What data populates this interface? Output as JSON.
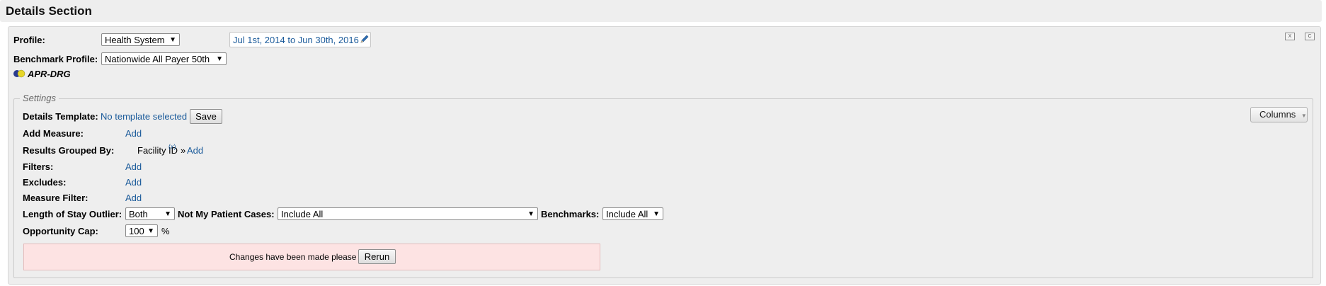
{
  "header": {
    "title": "Details Section"
  },
  "profile": {
    "label": "Profile:",
    "value": "Health System",
    "date_range": "Jul 1st, 2014 to Jun 30th, 2016",
    "benchmark_label": "Benchmark Profile:",
    "benchmark_value": "Nationwide All Payer 50th",
    "grouper": "APR-DRG"
  },
  "settings": {
    "legend": "Settings",
    "columns_button": "Columns",
    "details_template_label": "Details Template:",
    "details_template_value": "No template selected",
    "save_button": "Save",
    "add_measure_label": "Add Measure:",
    "add_link": "Add",
    "results_grouped_label": "Results Grouped By:",
    "grouped_value": "Facility ID",
    "grouped_remove": "(x)",
    "grouped_separator": "»",
    "filters_label": "Filters:",
    "excludes_label": "Excludes:",
    "measure_filter_label": "Measure Filter:",
    "los_outlier_label": "Length of Stay Outlier:",
    "los_outlier_value": "Both",
    "not_my_patient_label": "Not My Patient Cases:",
    "not_my_patient_value": "Include All",
    "benchmarks_label": "Benchmarks:",
    "benchmarks_value": "Include All",
    "opportunity_cap_label": "Opportunity Cap:",
    "opportunity_cap_value": "100",
    "opportunity_cap_unit": "%",
    "alert_text": "Changes have been made please",
    "rerun_button": "Rerun"
  },
  "icons": {
    "dropdown": "▼",
    "edit": "pencil-icon",
    "toggle": "toggle-icon",
    "export_1": "export-excel-icon",
    "export_2": "export-csv-icon"
  },
  "colors": {
    "link": "#1a5a9a",
    "panel_bg": "#eeeeee",
    "alert_bg": "#fde3e3"
  }
}
